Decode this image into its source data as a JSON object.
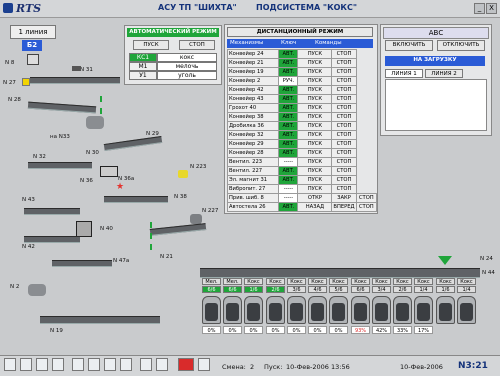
{
  "header": {
    "logo": "RTS",
    "title": "АСУ ТП \"ШИХТА\"",
    "subsystem": "ПОДСИСТЕМА \"КОКС\"",
    "win_min": "_",
    "win_close": "X"
  },
  "left": {
    "line_label": "1 линия",
    "b_label": "Б2",
    "labels": {
      "n8": "N 8",
      "n31": "N 31",
      "n27": "N 27",
      "n28": "N 28",
      "n1": "N 1",
      "n33": "на N33",
      "n29": "N 29",
      "n32": "N 32",
      "n30": "N 30",
      "n36": "N 36",
      "n36a": "N 36а",
      "n223": "N 223",
      "n38": "N 38",
      "n43": "N 43",
      "n42": "N 42",
      "n40": "N 40",
      "n227": "N 227",
      "n47a": "N 47а",
      "n21": "N 21",
      "n2": "N 2",
      "n19": "N 19",
      "n24": "N 24",
      "n44": "N 44"
    }
  },
  "auto": {
    "title": "АВТОМАТИЧЕСКИЙ РЕЖИМ",
    "start": "ПУСК",
    "stop": "СТОП",
    "rows": [
      {
        "k": "КС1",
        "v": "кокс"
      },
      {
        "k": "М1",
        "v": "мелочь"
      },
      {
        "k": "У1",
        "v": "уголь"
      }
    ]
  },
  "remote": {
    "title": "ДИСТАНЦИОННЫЙ РЕЖИМ",
    "col_mech": "Механизмы",
    "col_key": "Ключ",
    "col_cmd": "Команды",
    "rows": [
      {
        "name": "Конвейер 24",
        "key": "АВТ.",
        "c1": "ПУСК",
        "c2": "СТОП",
        "g": true
      },
      {
        "name": "Конвейер 21",
        "key": "АВТ.",
        "c1": "ПУСК",
        "c2": "СТОП",
        "g": true
      },
      {
        "name": "Конвейер 19",
        "key": "АВТ.",
        "c1": "ПУСК",
        "c2": "СТОП",
        "g": true
      },
      {
        "name": "Конвейер 2",
        "key": "РУЧ.",
        "c1": "ПУСК",
        "c2": "СТОП",
        "g": false
      },
      {
        "name": "Конвейер 42",
        "key": "АВТ.",
        "c1": "ПУСК",
        "c2": "СТОП",
        "g": true
      },
      {
        "name": "Конвейер 43",
        "key": "АВТ.",
        "c1": "ПУСК",
        "c2": "СТОП",
        "g": true
      },
      {
        "name": "Грохот 40",
        "key": "АВТ.",
        "c1": "ПУСК",
        "c2": "СТОП",
        "g": true
      },
      {
        "name": "Конвейер 38",
        "key": "АВТ.",
        "c1": "ПУСК",
        "c2": "СТОП",
        "g": true
      },
      {
        "name": "Дробилка 36",
        "key": "АВТ.",
        "c1": "ПУСК",
        "c2": "СТОП",
        "g": true
      },
      {
        "name": "Конвейер 32",
        "key": "АВТ.",
        "c1": "ПУСК",
        "c2": "СТОП",
        "g": true
      },
      {
        "name": "Конвейер 29",
        "key": "АВТ.",
        "c1": "ПУСК",
        "c2": "СТОП",
        "g": true
      },
      {
        "name": "Конвейер 28",
        "key": "АВТ.",
        "c1": "ПУСК",
        "c2": "СТОП",
        "g": true
      },
      {
        "name": "Вентил. 223",
        "key": "-----",
        "c1": "ПУСК",
        "c2": "СТОП",
        "g": false
      },
      {
        "name": "Вентил. 227",
        "key": "АВТ.",
        "c1": "ПУСК",
        "c2": "СТОП",
        "g": true
      },
      {
        "name": "Эл. магнит 31",
        "key": "АВТ.",
        "c1": "ПУСК",
        "c2": "СТОП",
        "g": true
      },
      {
        "name": "Вибропит. 27",
        "key": "-----",
        "c1": "ПУСК",
        "c2": "СТОП",
        "g": false
      },
      {
        "name": "Прив. шиб. 8",
        "key": "-----",
        "c1": "ОТКР",
        "c2": "ЗАКР",
        "c3": "СТОП",
        "g": false
      },
      {
        "name": "Автостела 26",
        "key": "АВТ.",
        "c1": "НАЗАД",
        "c2": "ВПЕРЕД",
        "c3": "СТОП",
        "g": true
      }
    ]
  },
  "abc": {
    "title": "АВС",
    "on": "ВКЛЮЧИТЬ",
    "off": "ОТКЛЮЧИТЬ",
    "load": "НА ЗАГРУЗКУ",
    "tab1": "ЛИНИЯ 1",
    "tab2": "ЛИНИЯ 2"
  },
  "bunkers": {
    "types": [
      "Мел.",
      "Мел.",
      "Кокс",
      "Кокс",
      "Кокс",
      "Кокс",
      "Кокс",
      "Кокс",
      "Кокс",
      "Кокс",
      "Кокс",
      "Кокс",
      "Кокс"
    ],
    "sizes": [
      "6/6",
      "6/6",
      "1/6",
      "2/6",
      "3/6",
      "4/6",
      "5/6",
      "6/6",
      "3/4",
      "2/6",
      "1/4",
      "1/6",
      "1/4"
    ],
    "pct": [
      "0%",
      "0%",
      "0%",
      "0%",
      "0%",
      "0%",
      "0%",
      "93%",
      "42%",
      "33%",
      "17%"
    ]
  },
  "status": {
    "shift_label": "Смена:",
    "shift": "2",
    "start_label": "Пуск:",
    "start": "10-Фев-2006 13:56",
    "date": "10-Фев-2006",
    "clock": "N3:21"
  },
  "colors": {
    "green": "#1fa53a",
    "blue": "#2a5bd6",
    "navy": "#13327a"
  }
}
